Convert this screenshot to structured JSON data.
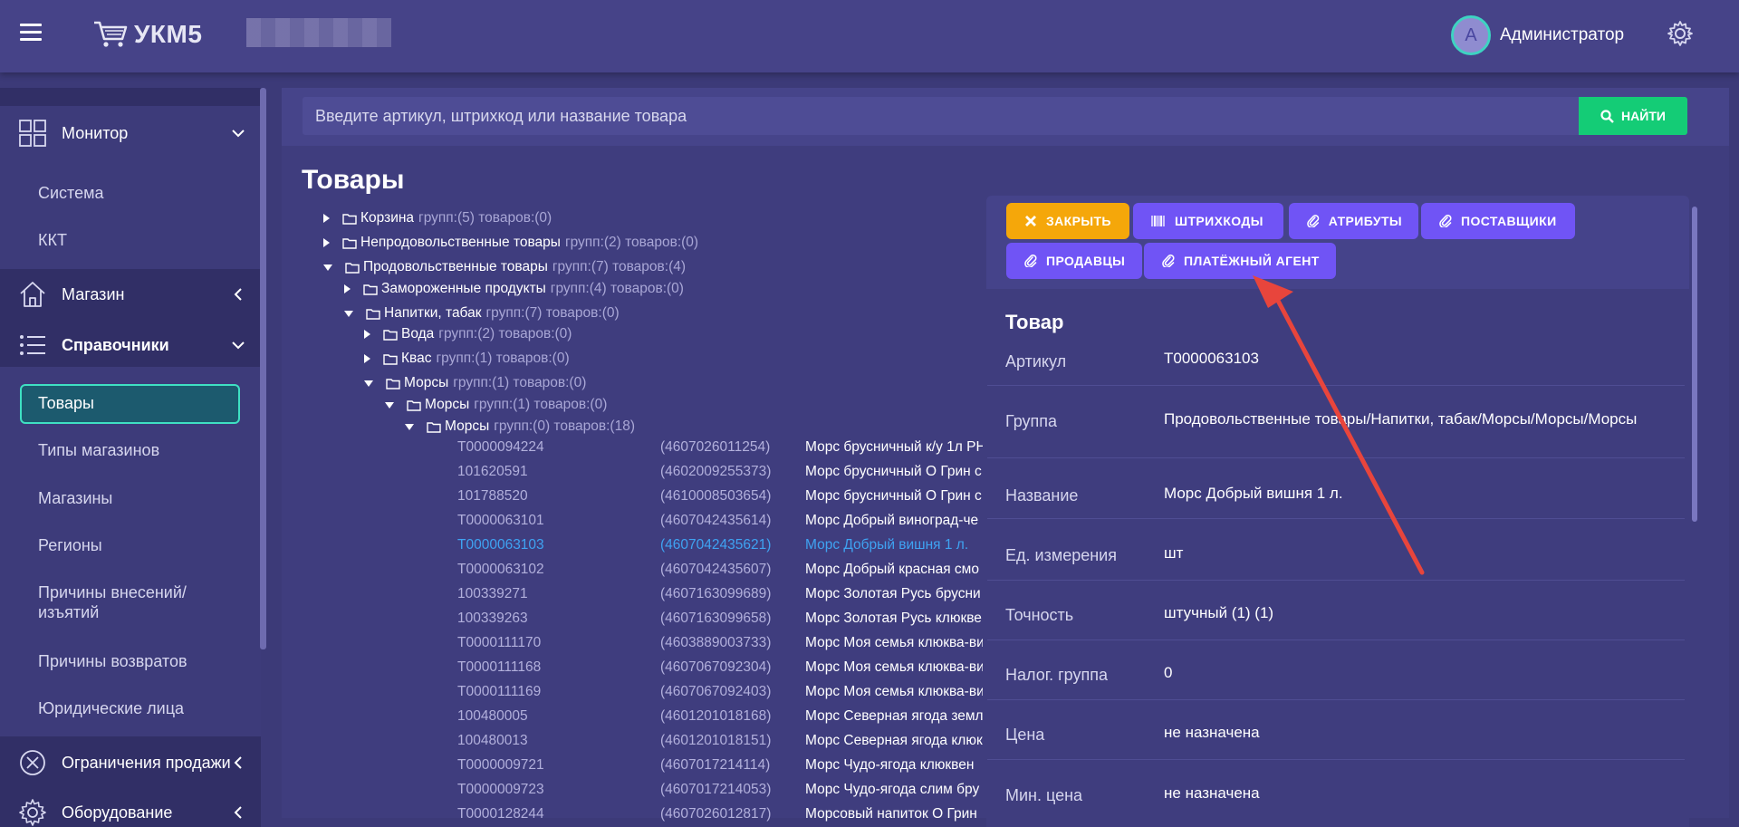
{
  "header": {
    "logo_text": "УКМ5",
    "user_initial": "А",
    "user_name": "Администратор"
  },
  "sidebar": {
    "monitor": "Монитор",
    "system": "Система",
    "kkt": "ККТ",
    "shop": "Магазин",
    "directories": "Справочники",
    "items": [
      "Товары",
      "Типы магазинов",
      "Магазины",
      "Регионы",
      "Причины внесений/",
      "изъятий",
      "Причины возвратов",
      "Юридические лица"
    ],
    "sales_limits": "Ограничения продажи",
    "equipment": "Оборудование"
  },
  "search": {
    "placeholder": "Введите артикул, штрихкод или название товара",
    "button": "НАЙТИ"
  },
  "page_title": "Товары",
  "tree": [
    {
      "name": "Корзина",
      "meta": "групп:(5) товаров:(0)"
    },
    {
      "name": "Непродовольственные товары",
      "meta": "групп:(2) товаров:(0)"
    },
    {
      "name": "Продовольственные товары",
      "meta": "групп:(7) товаров:(4)"
    },
    {
      "name": "Замороженные продукты",
      "meta": "групп:(4) товаров:(0)"
    },
    {
      "name": "Напитки, табак",
      "meta": "групп:(7) товаров:(0)"
    },
    {
      "name": "Вода",
      "meta": "групп:(2) товаров:(0)"
    },
    {
      "name": "Квас",
      "meta": "групп:(1) товаров:(0)"
    },
    {
      "name": "Морсы",
      "meta": "групп:(1) товаров:(0)"
    },
    {
      "name": "Морсы",
      "meta": "групп:(1) товаров:(0)"
    },
    {
      "name": "Морсы",
      "meta": "групп:(0) товаров:(18)"
    }
  ],
  "products": [
    {
      "article": "T0000094224",
      "barcode": "(4607026011254)",
      "name": "Морс брусничный к/у 1л РН"
    },
    {
      "article": "101620591",
      "barcode": "(4602009255373)",
      "name": "Морс брусничный О Грин с"
    },
    {
      "article": "101788520",
      "barcode": "(4610008503654)",
      "name": "Морс брусничный О Грин с"
    },
    {
      "article": "T0000063101",
      "barcode": "(4607042435614)",
      "name": "Морс Добрый виноград-че"
    },
    {
      "article": "T0000063103",
      "barcode": "(4607042435621)",
      "name": "Морс Добрый вишня 1 л."
    },
    {
      "article": "T0000063102",
      "barcode": "(4607042435607)",
      "name": "Морс Добрый красная смо"
    },
    {
      "article": "100339271",
      "barcode": "(4607163099689)",
      "name": "Морс Золотая Русь брусни"
    },
    {
      "article": "100339263",
      "barcode": "(4607163099658)",
      "name": "Морс Золотая Русь клюкве"
    },
    {
      "article": "T0000111170",
      "barcode": "(4603889003733)",
      "name": "Морс Моя семья клюква-ви"
    },
    {
      "article": "T0000111168",
      "barcode": "(4607067092304)",
      "name": "Морс Моя семья клюква-ви"
    },
    {
      "article": "T0000111169",
      "barcode": "(4607067092403)",
      "name": "Морс Моя семья клюква-ви"
    },
    {
      "article": "100480005",
      "barcode": "(4601201018168)",
      "name": "Морс Северная ягода земл"
    },
    {
      "article": "100480013",
      "barcode": "(4601201018151)",
      "name": "Морс Северная ягода клюк"
    },
    {
      "article": "T0000009721",
      "barcode": "(4607017214114)",
      "name": "Морс Чудо-ягода клюквен"
    },
    {
      "article": "T0000009723",
      "barcode": "(4607017214053)",
      "name": "Морс Чудо-ягода слим бру"
    },
    {
      "article": "T0000128244",
      "barcode": "(4607026012817)",
      "name": "Морсовый напиток О Грин"
    }
  ],
  "panel": {
    "buttons": [
      "ЗАКРЫТЬ",
      "ШТРИХКОДЫ",
      "АТРИБУТЫ",
      "ПОСТАВЩИКИ",
      "ПРОДАВЦЫ",
      "ПЛАТЁЖНЫЙ АГЕНТ"
    ],
    "section_title": "Товар",
    "fields": [
      {
        "label": "Артикул",
        "value": "T0000063103"
      },
      {
        "label": "Группа",
        "value": "Продовольственные товары/Напитки, табак/Морсы/Морсы/Морсы"
      },
      {
        "label": "Название",
        "value": "Морс Добрый вишня 1 л."
      },
      {
        "label": "Ед. измерения",
        "value": "шт"
      },
      {
        "label": "Точность",
        "value": "штучный (1) (1)"
      },
      {
        "label": "Налог. группа",
        "value": "0"
      },
      {
        "label": "Цена",
        "value": "не назначена"
      },
      {
        "label": "Мин. цена",
        "value": "не назначена"
      }
    ]
  },
  "colors": {
    "accent_green": "#14cc76",
    "accent_orange": "#f5a70a",
    "accent_purple": "#7054f5",
    "selected_blue": "#3fa3f2",
    "annotation_red": "#e8453c"
  }
}
